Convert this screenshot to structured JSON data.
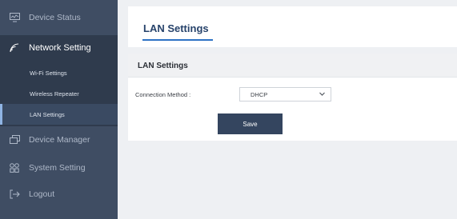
{
  "sidebar": {
    "device_status": {
      "label": "Device Status",
      "icon": "monitor-icon"
    },
    "network_setting": {
      "label": "Network Setting",
      "icon": "wifi-icon",
      "expanded": true,
      "items": [
        {
          "label": "Wi-Fi Settings"
        },
        {
          "label": "Wireless Repeater"
        },
        {
          "label": "LAN Settings",
          "active": true
        }
      ]
    },
    "device_manager": {
      "label": "Device Manager",
      "icon": "device-manager-icon"
    },
    "system_setting": {
      "label": "System Setting",
      "icon": "settings-grid-icon"
    },
    "logout": {
      "label": "Logout",
      "icon": "logout-icon"
    }
  },
  "header": {
    "title": "LAN Settings"
  },
  "panel": {
    "title": "LAN Settings",
    "connection_method_label": "Connection Method :",
    "connection_method_value": "DHCP",
    "save_label": "Save"
  },
  "colors": {
    "sidebar_bg": "#3f4d63",
    "sidebar_group_bg": "#2f3b4d",
    "accent": "#2d72c4",
    "button_bg": "#34455f"
  }
}
